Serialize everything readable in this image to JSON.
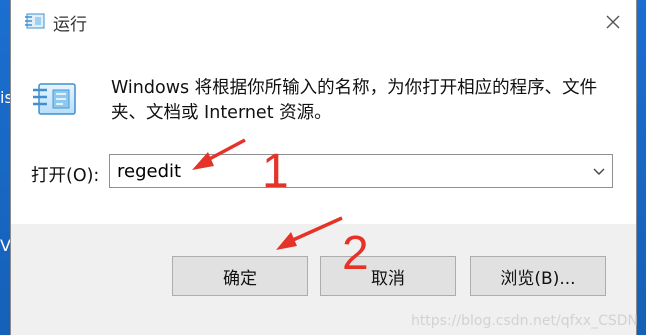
{
  "desktop": {
    "fragment_top": "is",
    "fragment_bottom": "V"
  },
  "window": {
    "title": "运行"
  },
  "content": {
    "description": "Windows 将根据你所输入的名称，为你打开相应的程序、文件夹、文档或 Internet 资源。",
    "open_label": "打开(O):",
    "input_value": "regedit"
  },
  "buttons": {
    "ok": "确定",
    "cancel": "取消",
    "browse": "浏览(B)..."
  },
  "annotations": {
    "step1": "1",
    "step2": "2",
    "color": "#e53329"
  },
  "watermark": "https://blog.csdn.net/qfxx_CSDN",
  "icons": [
    "run-app-icon",
    "close-icon",
    "chevron-down-icon",
    "annotation-arrow"
  ]
}
